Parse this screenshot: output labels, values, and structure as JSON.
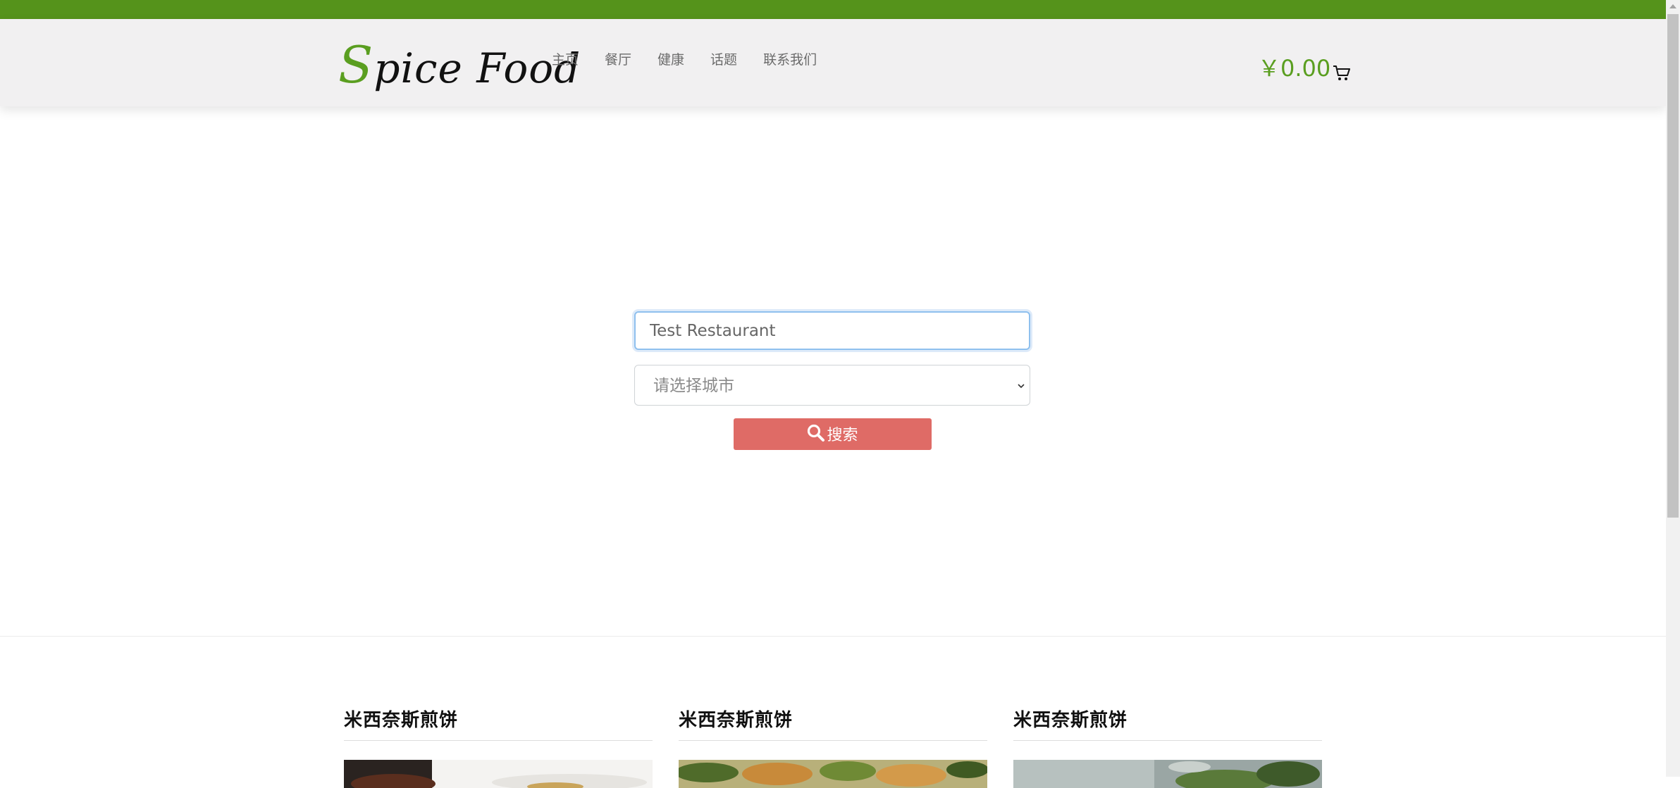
{
  "header": {
    "logo": {
      "first_letter": "S",
      "rest_first": "pice ",
      "second_word": "Food"
    },
    "nav": [
      "主页",
      "餐厅",
      "健康",
      "话题",
      "联系我们"
    ],
    "cart_amount": "￥0.00",
    "cart_icon": "cart-icon"
  },
  "search": {
    "input_value": "Test Restaurant",
    "city_select_value": "请选择城市",
    "button_label": "搜索",
    "button_icon": "search-icon"
  },
  "cards": [
    {
      "title": "米西奈斯煎饼"
    },
    {
      "title": "米西奈斯煎饼"
    },
    {
      "title": "米西奈斯煎饼"
    }
  ],
  "colors": {
    "brand_green": "#55931b",
    "accent_green": "#5a9e20",
    "search_button": "#df6b66"
  }
}
